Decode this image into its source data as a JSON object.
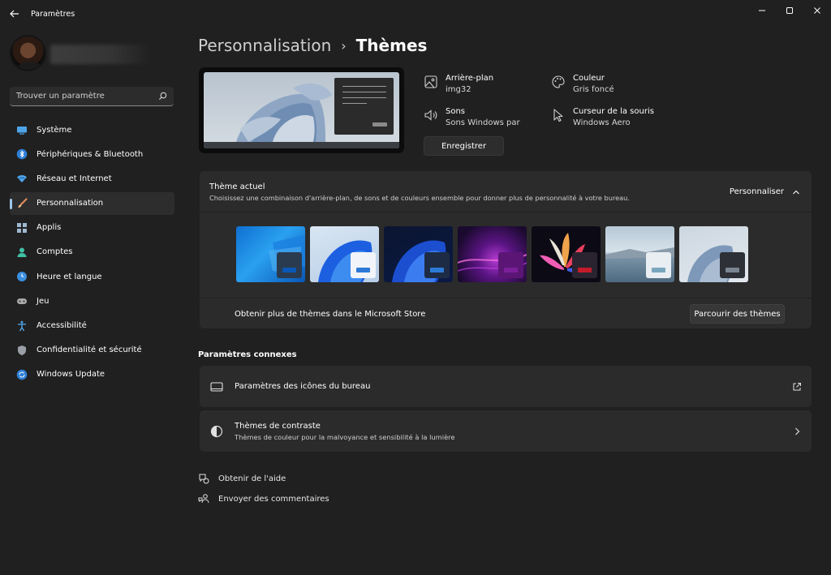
{
  "window": {
    "title": "Paramètres"
  },
  "search": {
    "placeholder": "Trouver un paramètre"
  },
  "sidebar": {
    "items": [
      {
        "label": "Système"
      },
      {
        "label": "Périphériques & Bluetooth"
      },
      {
        "label": "Réseau et Internet"
      },
      {
        "label": "Personnalisation",
        "active": true
      },
      {
        "label": "Applis"
      },
      {
        "label": "Comptes"
      },
      {
        "label": "Heure et langue"
      },
      {
        "label": "Jeu"
      },
      {
        "label": "Accessibilité"
      },
      {
        "label": "Confidentialité et sécurité"
      },
      {
        "label": "Windows Update"
      }
    ]
  },
  "breadcrumb": {
    "parent": "Personnalisation",
    "separator": "›",
    "current": "Thèmes"
  },
  "properties": {
    "background": {
      "title": "Arrière-plan",
      "value": "img32"
    },
    "color": {
      "title": "Couleur",
      "value": "Gris foncé"
    },
    "sounds": {
      "title": "Sons",
      "value": "Sons Windows par"
    },
    "cursor": {
      "title": "Curseur de la souris",
      "value": "Windows Aero"
    },
    "save_label": "Enregistrer"
  },
  "current_theme": {
    "title": "Thème actuel",
    "description": "Choisissez une combinaison d'arrière-plan, de sons et de couleurs ensemble pour donner plus de personnalité à votre bureau.",
    "customize_label": "Personnaliser",
    "store_text": "Obtenir plus de thèmes dans le Microsoft Store",
    "browse_label": "Parcourir des thèmes"
  },
  "related": {
    "title": "Paramètres connexes",
    "desktop_icons": {
      "title": "Paramètres des icônes du bureau"
    },
    "contrast": {
      "title": "Thèmes de contraste",
      "subtitle": "Thèmes de couleur pour la malvoyance et sensibilité à la lumière"
    }
  },
  "footer": {
    "help": "Obtenir de l'aide",
    "feedback": "Envoyer des commentaires"
  },
  "colors": {
    "background": "#202020",
    "panel": "#2b2b2b",
    "accent": "#9ec6ea"
  }
}
